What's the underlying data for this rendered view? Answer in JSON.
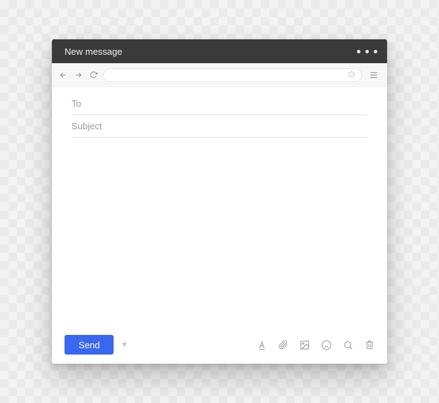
{
  "titlebar": {
    "title": "New message"
  },
  "fields": {
    "to_placeholder": "To",
    "to_value": "",
    "subject_placeholder": "Subject",
    "subject_value": ""
  },
  "footer": {
    "send_label": "Send"
  },
  "colors": {
    "accent": "#3a67f0",
    "titlebar": "#3a3a3a"
  }
}
